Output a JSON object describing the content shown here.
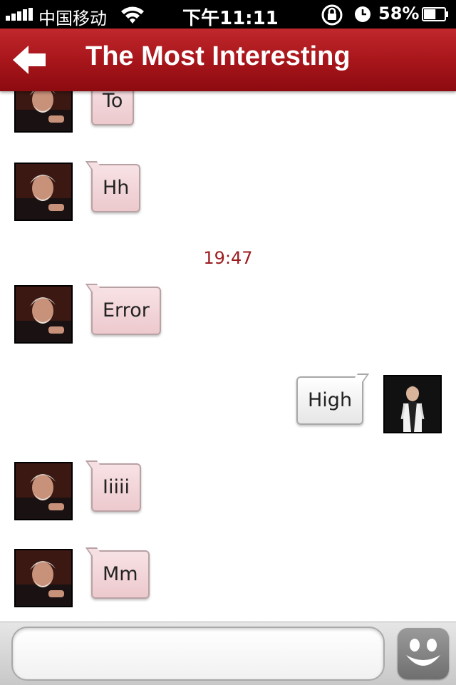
{
  "status_bar": {
    "carrier": "中国移动",
    "time": "下午11:11",
    "battery_percent": "58%",
    "battery_level": 0.58
  },
  "nav": {
    "title": "The Most Interesting",
    "back_icon": "back-arrow-icon"
  },
  "messages": [
    {
      "from": "them",
      "text": "To"
    },
    {
      "from": "them",
      "text": "Hh"
    },
    {
      "type": "time",
      "text": "19:47"
    },
    {
      "from": "them",
      "text": "Error"
    },
    {
      "from": "me",
      "text": "High"
    },
    {
      "from": "them",
      "text": "Iiiii"
    },
    {
      "from": "them",
      "text": "Mm"
    }
  ],
  "input": {
    "placeholder": "",
    "value": "",
    "emoji_icon": "smiley-icon"
  },
  "colors": {
    "nav": "#a8161b",
    "incoming_bubble": "#f1d3d6",
    "outgoing_bubble": "#f2f2f2",
    "timestamp": "#9c1c20"
  }
}
